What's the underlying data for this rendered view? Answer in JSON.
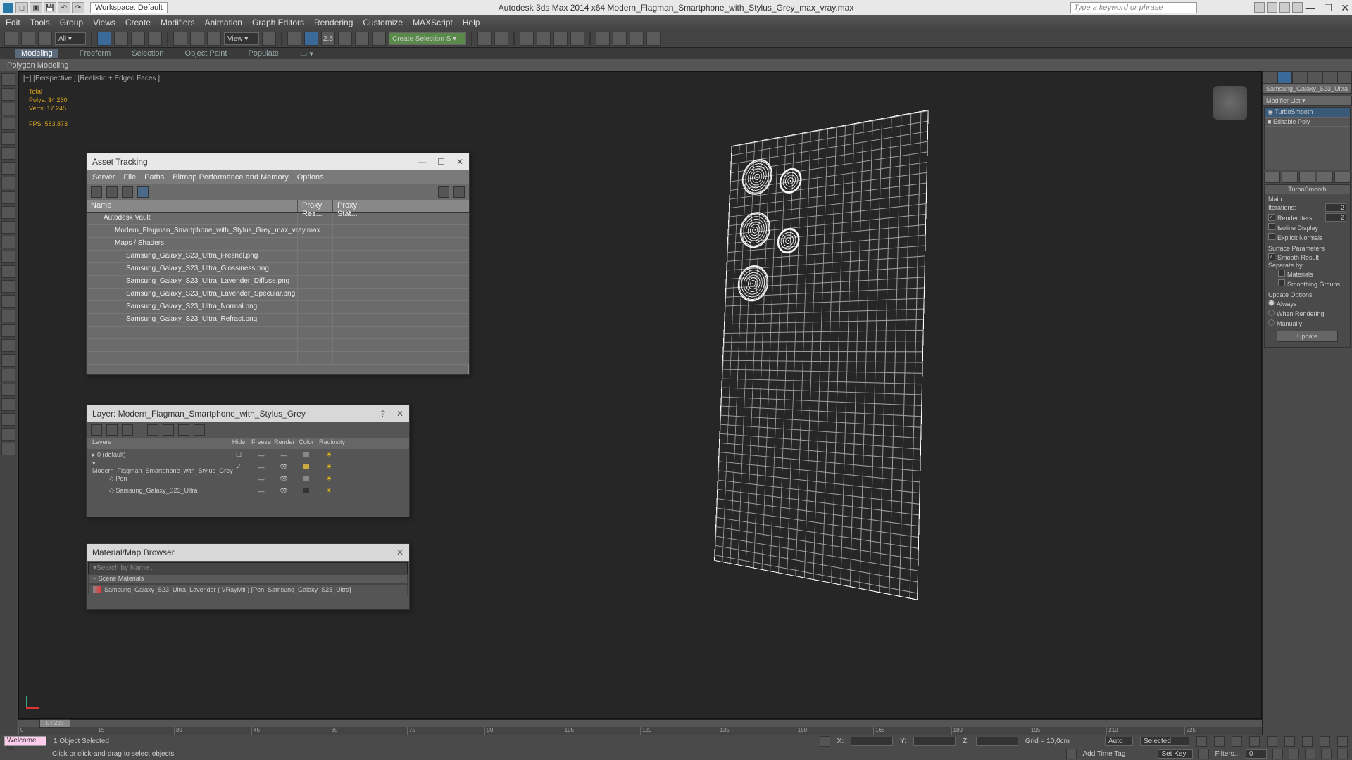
{
  "title": "Autodesk 3ds Max  2014 x64     Modern_Flagman_Smartphone_with_Stylus_Grey_max_vray.max",
  "workspace": "Workspace: Default",
  "search_placeholder": "Type a keyword or phrase",
  "menu": [
    "Edit",
    "Tools",
    "Group",
    "Views",
    "Create",
    "Modifiers",
    "Animation",
    "Graph Editors",
    "Rendering",
    "Customize",
    "MAXScript",
    "Help"
  ],
  "ribbon": {
    "tabs": [
      "Modeling",
      "Freeform",
      "Selection",
      "Object Paint",
      "Populate"
    ],
    "active": "Modeling",
    "sub": "Polygon Modeling"
  },
  "viewport": {
    "label": "[+] [Perspective ] [Realistic + Edged Faces ]",
    "stats": {
      "total": "Total",
      "polys_l": "Polys:",
      "polys": "34 260",
      "verts_l": "Verts:",
      "verts": "17 245",
      "fps_l": "FPS:",
      "fps": "583,873"
    }
  },
  "asset_panel": {
    "title": "Asset Tracking",
    "menu": [
      "Server",
      "File",
      "Paths",
      "Bitmap Performance and Memory",
      "Options"
    ],
    "headers": [
      "Name",
      "Proxy Res...",
      "Proxy Stat..."
    ],
    "rows": [
      {
        "indent": 1,
        "text": "Autodesk Vault"
      },
      {
        "indent": 2,
        "text": "Modern_Flagman_Smartphone_with_Stylus_Grey_max_vray.max"
      },
      {
        "indent": 2,
        "text": "Maps / Shaders"
      },
      {
        "indent": 3,
        "text": "Samsung_Galaxy_S23_Ultra_Fresnel.png"
      },
      {
        "indent": 3,
        "text": "Samsung_Galaxy_S23_Ultra_Glossiness.png"
      },
      {
        "indent": 3,
        "text": "Samsung_Galaxy_S23_Ultra_Lavender_Diffuse.png"
      },
      {
        "indent": 3,
        "text": "Samsung_Galaxy_S23_Ultra_Lavender_Specular.png"
      },
      {
        "indent": 3,
        "text": "Samsung_Galaxy_S23_Ultra_Normal.png"
      },
      {
        "indent": 3,
        "text": "Samsung_Galaxy_S23_Ultra_Refract.png"
      }
    ]
  },
  "layer_panel": {
    "title": "Layer: Modern_Flagman_Smartphone_with_Stylus_Grey",
    "headers": [
      "Layers",
      "Hide",
      "Freeze",
      "Render",
      "Color",
      "Radiosity"
    ],
    "rows": [
      {
        "name": "0 (default)",
        "indent": 0
      },
      {
        "name": "Modern_Flagman_Smartphone_with_Stylus_Grey",
        "indent": 0
      },
      {
        "name": "Pen",
        "indent": 2
      },
      {
        "name": "Samsung_Galaxy_S23_Ultra",
        "indent": 2
      }
    ]
  },
  "mat_panel": {
    "title": "Material/Map Browser",
    "search": "Search by Name ...",
    "group": "Scene Materials",
    "row": "Samsung_Galaxy_S23_Ultra_Lavender ( VRayMtl )  [Pen, Samsung_Galaxy_S23_Ultra]"
  },
  "cmd": {
    "obj": "Samsung_Galaxy_S23_Ultra",
    "modlist_label": "Modifier List",
    "mods": [
      "TurboSmooth",
      "Editable Poly"
    ],
    "rollout": "TurboSmooth",
    "main": "Main:",
    "iter_l": "Iterations:",
    "iter_v": "2",
    "riter_l": "Render Iters:",
    "riter_v": "2",
    "iso": "Isoline Display",
    "expl": "Explicit Normals",
    "surf": "Surface Parameters",
    "smooth": "Smooth Result",
    "sep": "Separate by:",
    "mat": "Materials",
    "sg": "Smoothing Groups",
    "upd": "Update Options",
    "always": "Always",
    "when": "When Rendering",
    "man": "Manually",
    "ubtn": "Update"
  },
  "timeline": {
    "knob": "0 / 225",
    "ticks": [
      "0",
      "15",
      "30",
      "45",
      "60",
      "75",
      "90",
      "105",
      "120",
      "135",
      "150",
      "165",
      "180",
      "195",
      "210",
      "225"
    ]
  },
  "status": {
    "sel": "1 Object Selected",
    "prompt": "Click or click-and-drag to select objects",
    "maxscript": "Welcome to",
    "x": "X:",
    "y": "Y:",
    "z": "Z:",
    "grid": "Grid = 10,0cm",
    "auto": "Auto",
    "selected": "Selected",
    "addtag": "Add Time Tag",
    "setkey": "Set Key",
    "filters": "Filters..."
  }
}
